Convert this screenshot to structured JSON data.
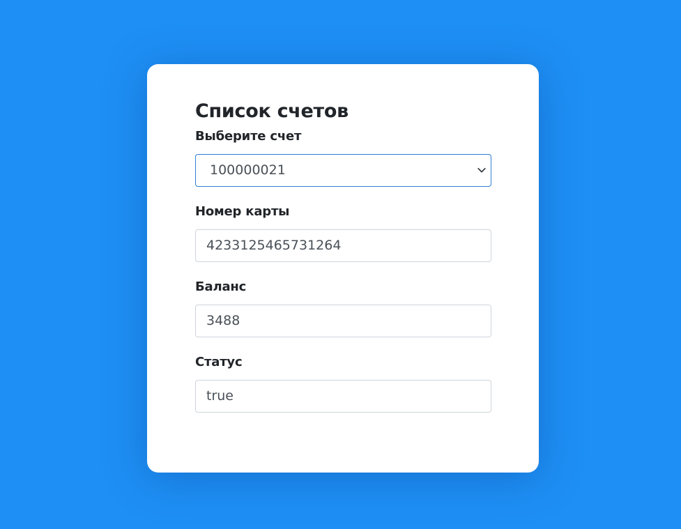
{
  "title": "Список счетов",
  "account_select": {
    "label": "Выберите счет",
    "selected_value": "100000021",
    "icon": "chevron-down-icon"
  },
  "card_number": {
    "label": "Номер карты",
    "value": "4233125465731264"
  },
  "balance": {
    "label": "Баланс",
    "value": "3488"
  },
  "status": {
    "label": "Статус",
    "value": "true"
  },
  "colors": {
    "background": "#1e8ff5",
    "card": "#ffffff",
    "text": "#212529",
    "input_text": "#495057",
    "input_border": "#ced4da",
    "focus_border": "#2f7fd6"
  }
}
